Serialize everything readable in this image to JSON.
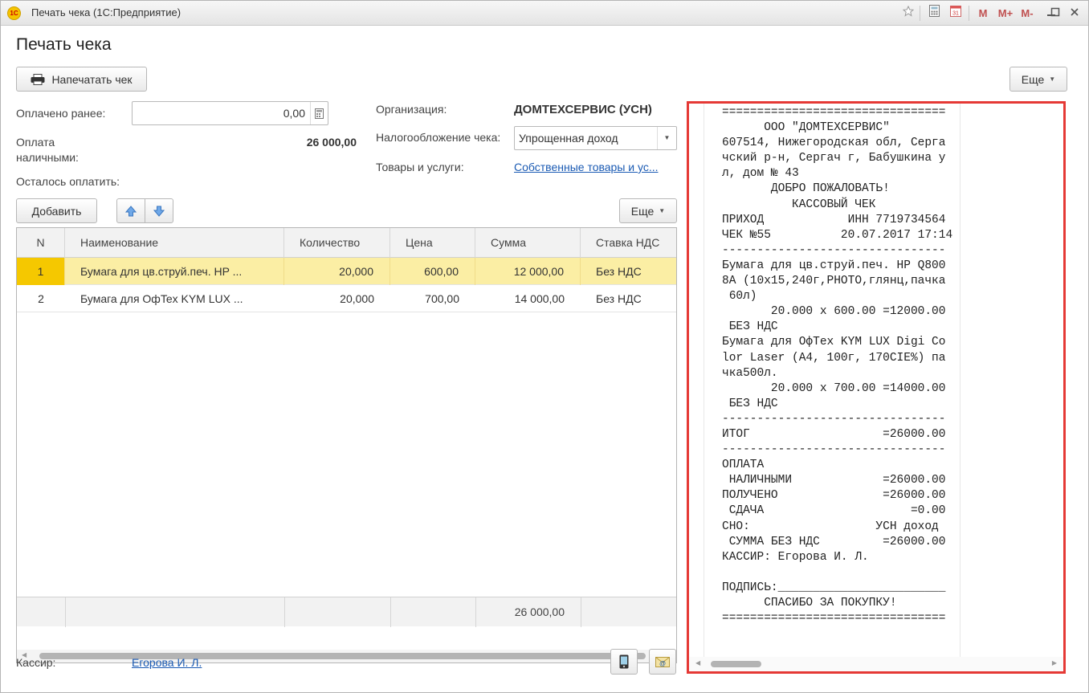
{
  "window": {
    "title": "Печать чека  (1С:Предприятие)",
    "buttons": {
      "m": "M",
      "m_plus": "M+",
      "m_minus": "M-"
    }
  },
  "page": {
    "title": "Печать чека"
  },
  "toolbar": {
    "print_label": "Напечатать чек",
    "more_label": "Еще"
  },
  "payment": {
    "paid_before_label": "Оплачено ранее:",
    "paid_before_value": "0,00",
    "cash_label_line1": "Оплата",
    "cash_label_line2": "наличными:",
    "cash_value": "26 000,00",
    "remaining_label": "Осталось оплатить:"
  },
  "org": {
    "org_label": "Организация:",
    "org_value": "ДОМТЕХСЕРВИС (УСН)",
    "tax_label": "Налогообложение чека:",
    "tax_value": "Упрощенная доход",
    "goods_label": "Товары и услуги:",
    "goods_value": "Собственные товары и ус..."
  },
  "table_toolbar": {
    "add_label": "Добавить",
    "more_label": "Еще"
  },
  "table": {
    "columns": [
      "N",
      "Наименование",
      "Количество",
      "Цена",
      "Сумма",
      "Ставка НДС"
    ],
    "rows": [
      {
        "n": "1",
        "name": "Бумага для цв.струй.печ. HP ...",
        "qty": "20,000",
        "price": "600,00",
        "sum": "12 000,00",
        "vat": "Без НДС"
      },
      {
        "n": "2",
        "name": "Бумага для OфTex KYM LUX ...",
        "qty": "20,000",
        "price": "700,00",
        "sum": "14 000,00",
        "vat": "Без НДС"
      }
    ],
    "total_sum": "26 000,00"
  },
  "cashier": {
    "label": "Кассир:",
    "value": "Егорова И. Л."
  },
  "receipt": {
    "lines": [
      "================================",
      "      ООО \"ДОМТЕХСЕРВИС\"",
      "607514, Нижегородская обл, Серга",
      "чский р-н, Сергач г, Бабушкина у",
      "л, дом № 43",
      "       ДОБРО ПОЖАЛОВАТЬ!",
      "          КАССОВЫЙ ЧЕК",
      "ПРИХОД            ИНН 7719734564",
      "ЧЕК №55          20.07.2017 17:14",
      "--------------------------------",
      "Бумага для цв.струй.печ. HP Q800",
      "8A (10x15,240г,PHOTO,глянц,пачка",
      " 60л)",
      "       20.000 x 600.00 =12000.00",
      " БЕЗ НДС",
      "Бумага для OфTex KYM LUX Digi Co",
      "lor Laser (A4, 100г, 170CIE%) па",
      "чка500л.",
      "       20.000 x 700.00 =14000.00",
      " БЕЗ НДС",
      "--------------------------------",
      "ИТОГ                   =26000.00",
      "--------------------------------",
      "ОПЛАТА",
      " НАЛИЧНЫМИ             =26000.00",
      "ПОЛУЧЕНО               =26000.00",
      " СДАЧА                     =0.00",
      "СНО:                  УСН доход",
      " СУММА БЕЗ НДС         =26000.00",
      "КАССИР: Егорова И. Л.",
      "",
      "ПОДПИСЬ:________________________",
      "      СПАСИБО ЗА ПОКУПКУ!",
      "================================"
    ]
  },
  "colors": {
    "selected_row": "#fbeea4",
    "selected_n_cell": "#f5c800",
    "link": "#1a5ab3",
    "receipt_border": "#e53935"
  }
}
